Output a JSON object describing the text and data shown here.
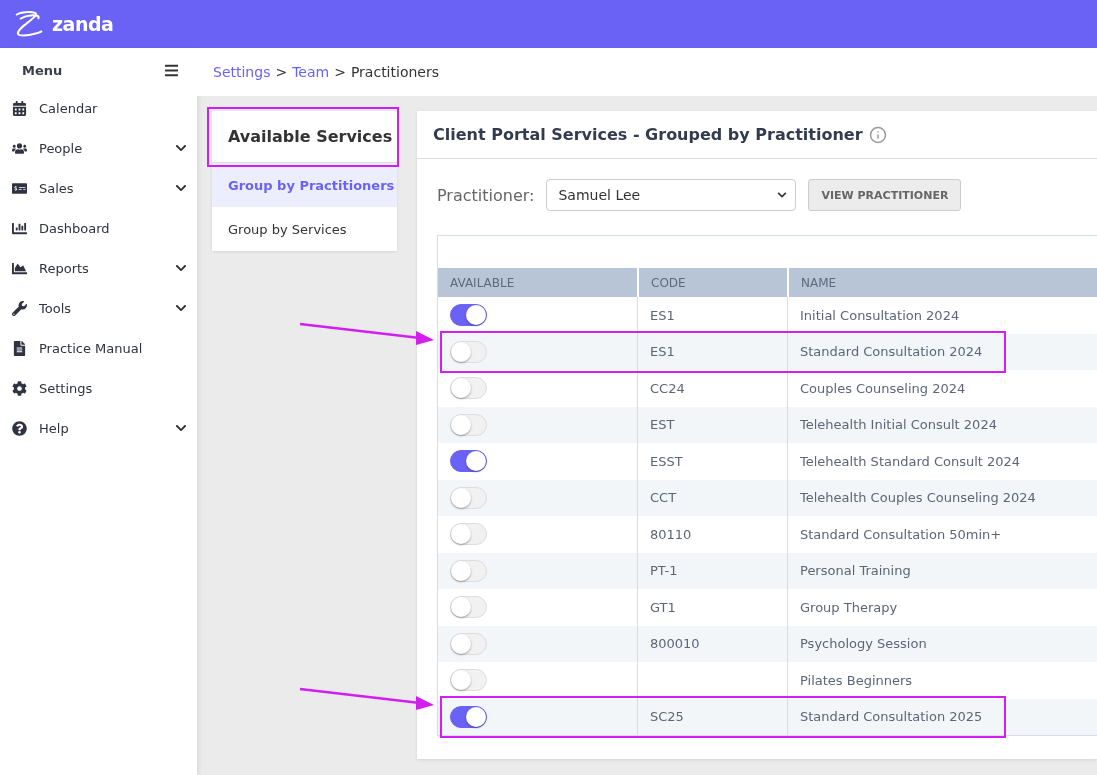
{
  "brand": {
    "name": "zanda"
  },
  "sidebar": {
    "title": "Menu",
    "items": [
      {
        "label": "Calendar",
        "expandable": false
      },
      {
        "label": "People",
        "expandable": true
      },
      {
        "label": "Sales",
        "expandable": true
      },
      {
        "label": "Dashboard",
        "expandable": false
      },
      {
        "label": "Reports",
        "expandable": true
      },
      {
        "label": "Tools",
        "expandable": true
      },
      {
        "label": "Practice Manual",
        "expandable": false
      },
      {
        "label": "Settings",
        "expandable": false
      },
      {
        "label": "Help",
        "expandable": true
      }
    ]
  },
  "breadcrumb": [
    {
      "label": "Settings",
      "link": true
    },
    {
      "separator": ">"
    },
    {
      "label": "Team",
      "link": true
    },
    {
      "separator": ">"
    },
    {
      "label": "Practitioners",
      "link": false
    }
  ],
  "services_nav": {
    "title": "Available Services",
    "annotated": true,
    "items": [
      {
        "label": "Group by Practitioners",
        "selected": true
      },
      {
        "label": "Group by Services",
        "selected": false
      }
    ]
  },
  "panel": {
    "title": "Client Portal Services - Grouped by Practitioner",
    "practitioner_label": "Practitioner:",
    "practitioner_value": "Samuel Lee",
    "view_button": "VIEW PRACTITIONER"
  },
  "table": {
    "columns": [
      "AVAILABLE",
      "CODE",
      "NAME"
    ],
    "rows": [
      {
        "available": true,
        "code": "ES1",
        "name": "Initial Consultation 2024",
        "annotated": false
      },
      {
        "available": false,
        "code": "ES1",
        "name": "Standard Consultation 2024",
        "annotated": true
      },
      {
        "available": false,
        "code": "CC24",
        "name": "Couples Counseling 2024",
        "annotated": false
      },
      {
        "available": false,
        "code": "EST",
        "name": "Telehealth Initial Consult 2024",
        "annotated": false
      },
      {
        "available": true,
        "code": "ESST",
        "name": "Telehealth Standard Consult 2024",
        "annotated": false
      },
      {
        "available": false,
        "code": "CCT",
        "name": "Telehealth Couples Counseling 2024",
        "annotated": false
      },
      {
        "available": false,
        "code": "80110",
        "name": "Standard Consultation 50min+",
        "annotated": false
      },
      {
        "available": false,
        "code": "PT-1",
        "name": "Personal Training",
        "annotated": false
      },
      {
        "available": false,
        "code": "GT1",
        "name": "Group Therapy",
        "annotated": false
      },
      {
        "available": false,
        "code": "800010",
        "name": "Psychology Session",
        "annotated": false
      },
      {
        "available": false,
        "name": "Pilates Beginners",
        "annotated": false
      },
      {
        "available": true,
        "code": "SC25",
        "name": "Standard Consultation 2025",
        "annotated": true
      }
    ]
  }
}
